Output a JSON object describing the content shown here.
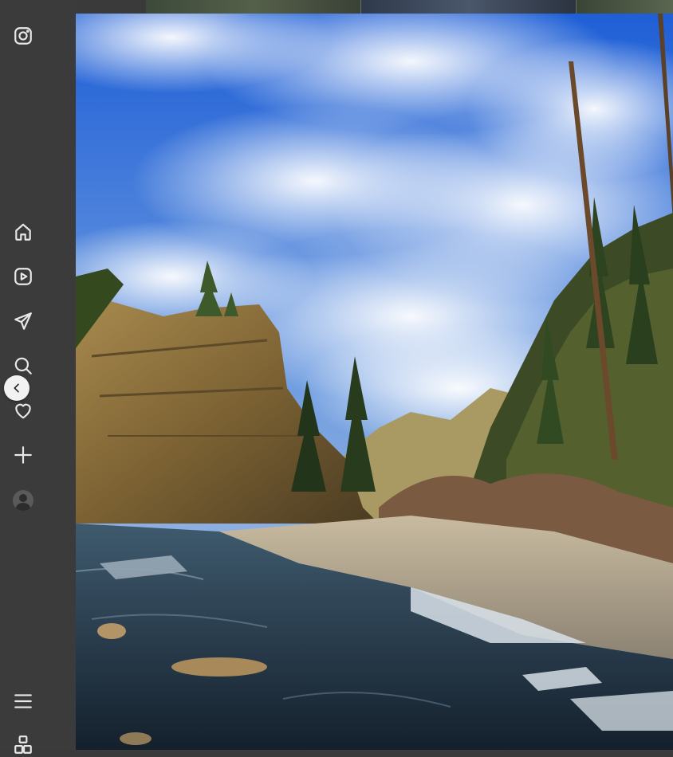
{
  "nav": {
    "items": [
      {
        "icon": "instagram-logo-icon"
      },
      {
        "icon": "home-icon"
      },
      {
        "icon": "reels-icon"
      },
      {
        "icon": "direct-messages-icon"
      },
      {
        "icon": "search-icon"
      },
      {
        "icon": "notifications-heart-icon"
      },
      {
        "icon": "create-plus-icon"
      },
      {
        "icon": "profile-avatar-icon"
      },
      {
        "icon": "menu-icon"
      },
      {
        "icon": "also-from-meta-icon"
      }
    ]
  },
  "viewer": {
    "prev_icon": "chevron-left-icon"
  },
  "colors": {
    "nav_bg": "#3b3b3b",
    "icon": "#e8e8e8",
    "button_bg": "#f2f2f2"
  }
}
